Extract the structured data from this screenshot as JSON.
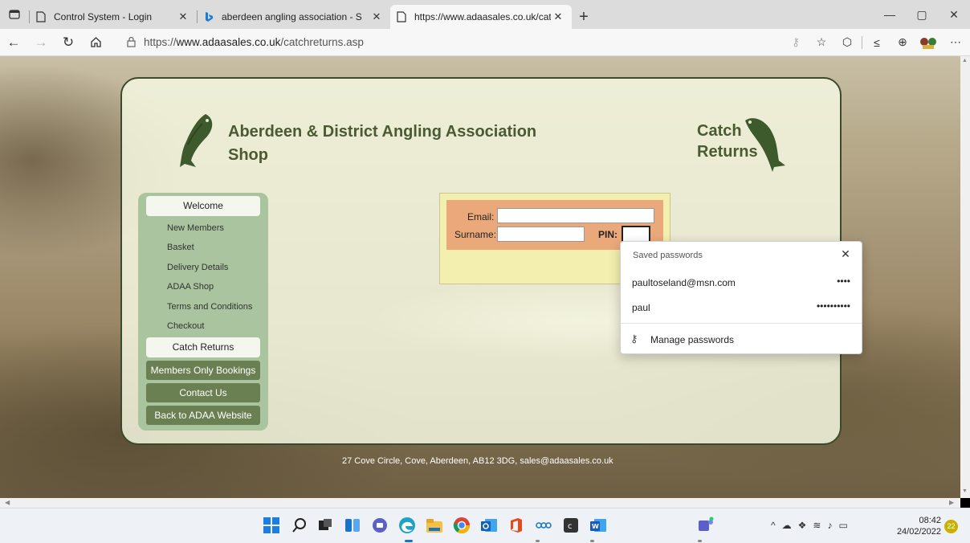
{
  "browser": {
    "tabs": [
      {
        "title": "Control System - Login",
        "active": false
      },
      {
        "title": "aberdeen angling association - S",
        "active": false
      },
      {
        "title": "https://www.adaasales.co.uk/cat",
        "active": true
      }
    ],
    "url_prefix": "https://",
    "url_host": "www.adaasales.co.uk",
    "url_path": "/catchreturns.asp"
  },
  "page": {
    "title_main": "Aberdeen & District Angling Association",
    "title_sub": "Shop",
    "title_right_1": "Catch",
    "title_right_2": "Returns",
    "nav": {
      "welcome": "Welcome",
      "links": [
        "New Members",
        "Basket",
        "Delivery Details",
        "ADAA Shop",
        "Terms and Conditions",
        "Checkout"
      ],
      "catch_returns": "Catch Returns",
      "members_only": "Members Only Bookings",
      "contact": "Contact Us",
      "back": "Back to ADAA Website"
    },
    "form": {
      "email_label": "Email:",
      "surname_label": "Surname:",
      "pin_label": "PIN:",
      "email_value": "",
      "surname_value": "",
      "pin_value": ""
    },
    "footer_address": "27 Cove Circle, Cove, Aberdeen, AB12 3DG, sales@adaasales.co.uk"
  },
  "password_popup": {
    "title": "Saved passwords",
    "entries": [
      {
        "user": "paultoseland@msn.com",
        "mask": "••••"
      },
      {
        "user": "paul",
        "mask": "••••••••••"
      }
    ],
    "manage_label": "Manage passwords"
  },
  "taskbar": {
    "time": "08:42",
    "date": "24/02/2022",
    "notifications": "22"
  },
  "colors": {
    "brand_green": "#4a5a33",
    "sidebar_green": "#a9c49e",
    "button_green": "#6a8052",
    "form_orange": "#eba97b",
    "form_yellow": "#f3efae"
  }
}
